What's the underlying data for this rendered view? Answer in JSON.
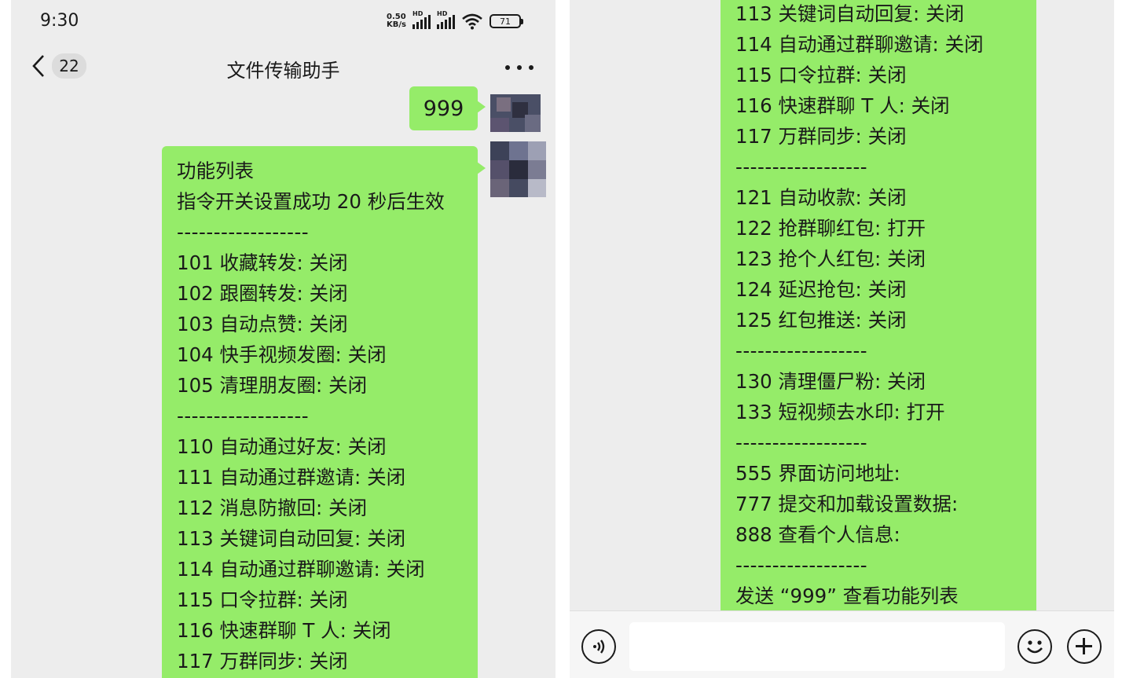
{
  "status_bar": {
    "time": "9:30",
    "net_speed_value": "0.50",
    "net_speed_unit": "KB/s",
    "signal_tag": "HD",
    "battery": "71"
  },
  "header": {
    "unread_count": "22",
    "title": "文件传输助手"
  },
  "messages": {
    "sent_command": "999",
    "function_list_left": [
      "功能列表",
      "指令开关设置成功 20 秒后生效",
      "------------------",
      "101 收藏转发: 关闭",
      "102 跟圈转发: 关闭",
      "103 自动点赞: 关闭",
      "104 快手视频发圈: 关闭",
      "105 清理朋友圈: 关闭",
      "------------------",
      "110 自动通过好友: 关闭",
      "111 自动通过群邀请: 关闭",
      "112 消息防撤回: 关闭",
      "113 关键词自动回复: 关闭",
      "114 自动通过群聊邀请: 关闭",
      "115 口令拉群: 关闭",
      "116 快速群聊 T 人: 关闭",
      "117 万群同步: 关闭"
    ],
    "function_list_right": [
      "113 关键词自动回复: 关闭",
      "114 自动通过群聊邀请: 关闭",
      "115 口令拉群: 关闭",
      "116 快速群聊 T 人: 关闭",
      "117 万群同步: 关闭",
      "------------------",
      "121 自动收款: 关闭",
      "122 抢群聊红包: 打开",
      "123 抢个人红包: 关闭",
      "124 延迟抢包: 关闭",
      "125 红包推送: 关闭",
      "------------------",
      "130 清理僵尸粉: 关闭",
      "133 短视频去水印: 打开",
      "------------------",
      "555 界面访问地址:",
      "777 提交和加载设置数据:",
      "888 查看个人信息:",
      "------------------",
      "发送 “999” 查看功能列表"
    ]
  },
  "input": {
    "value": "",
    "placeholder": ""
  },
  "colors": {
    "bubble_green": "#95ec69",
    "chat_background": "#ededed"
  }
}
